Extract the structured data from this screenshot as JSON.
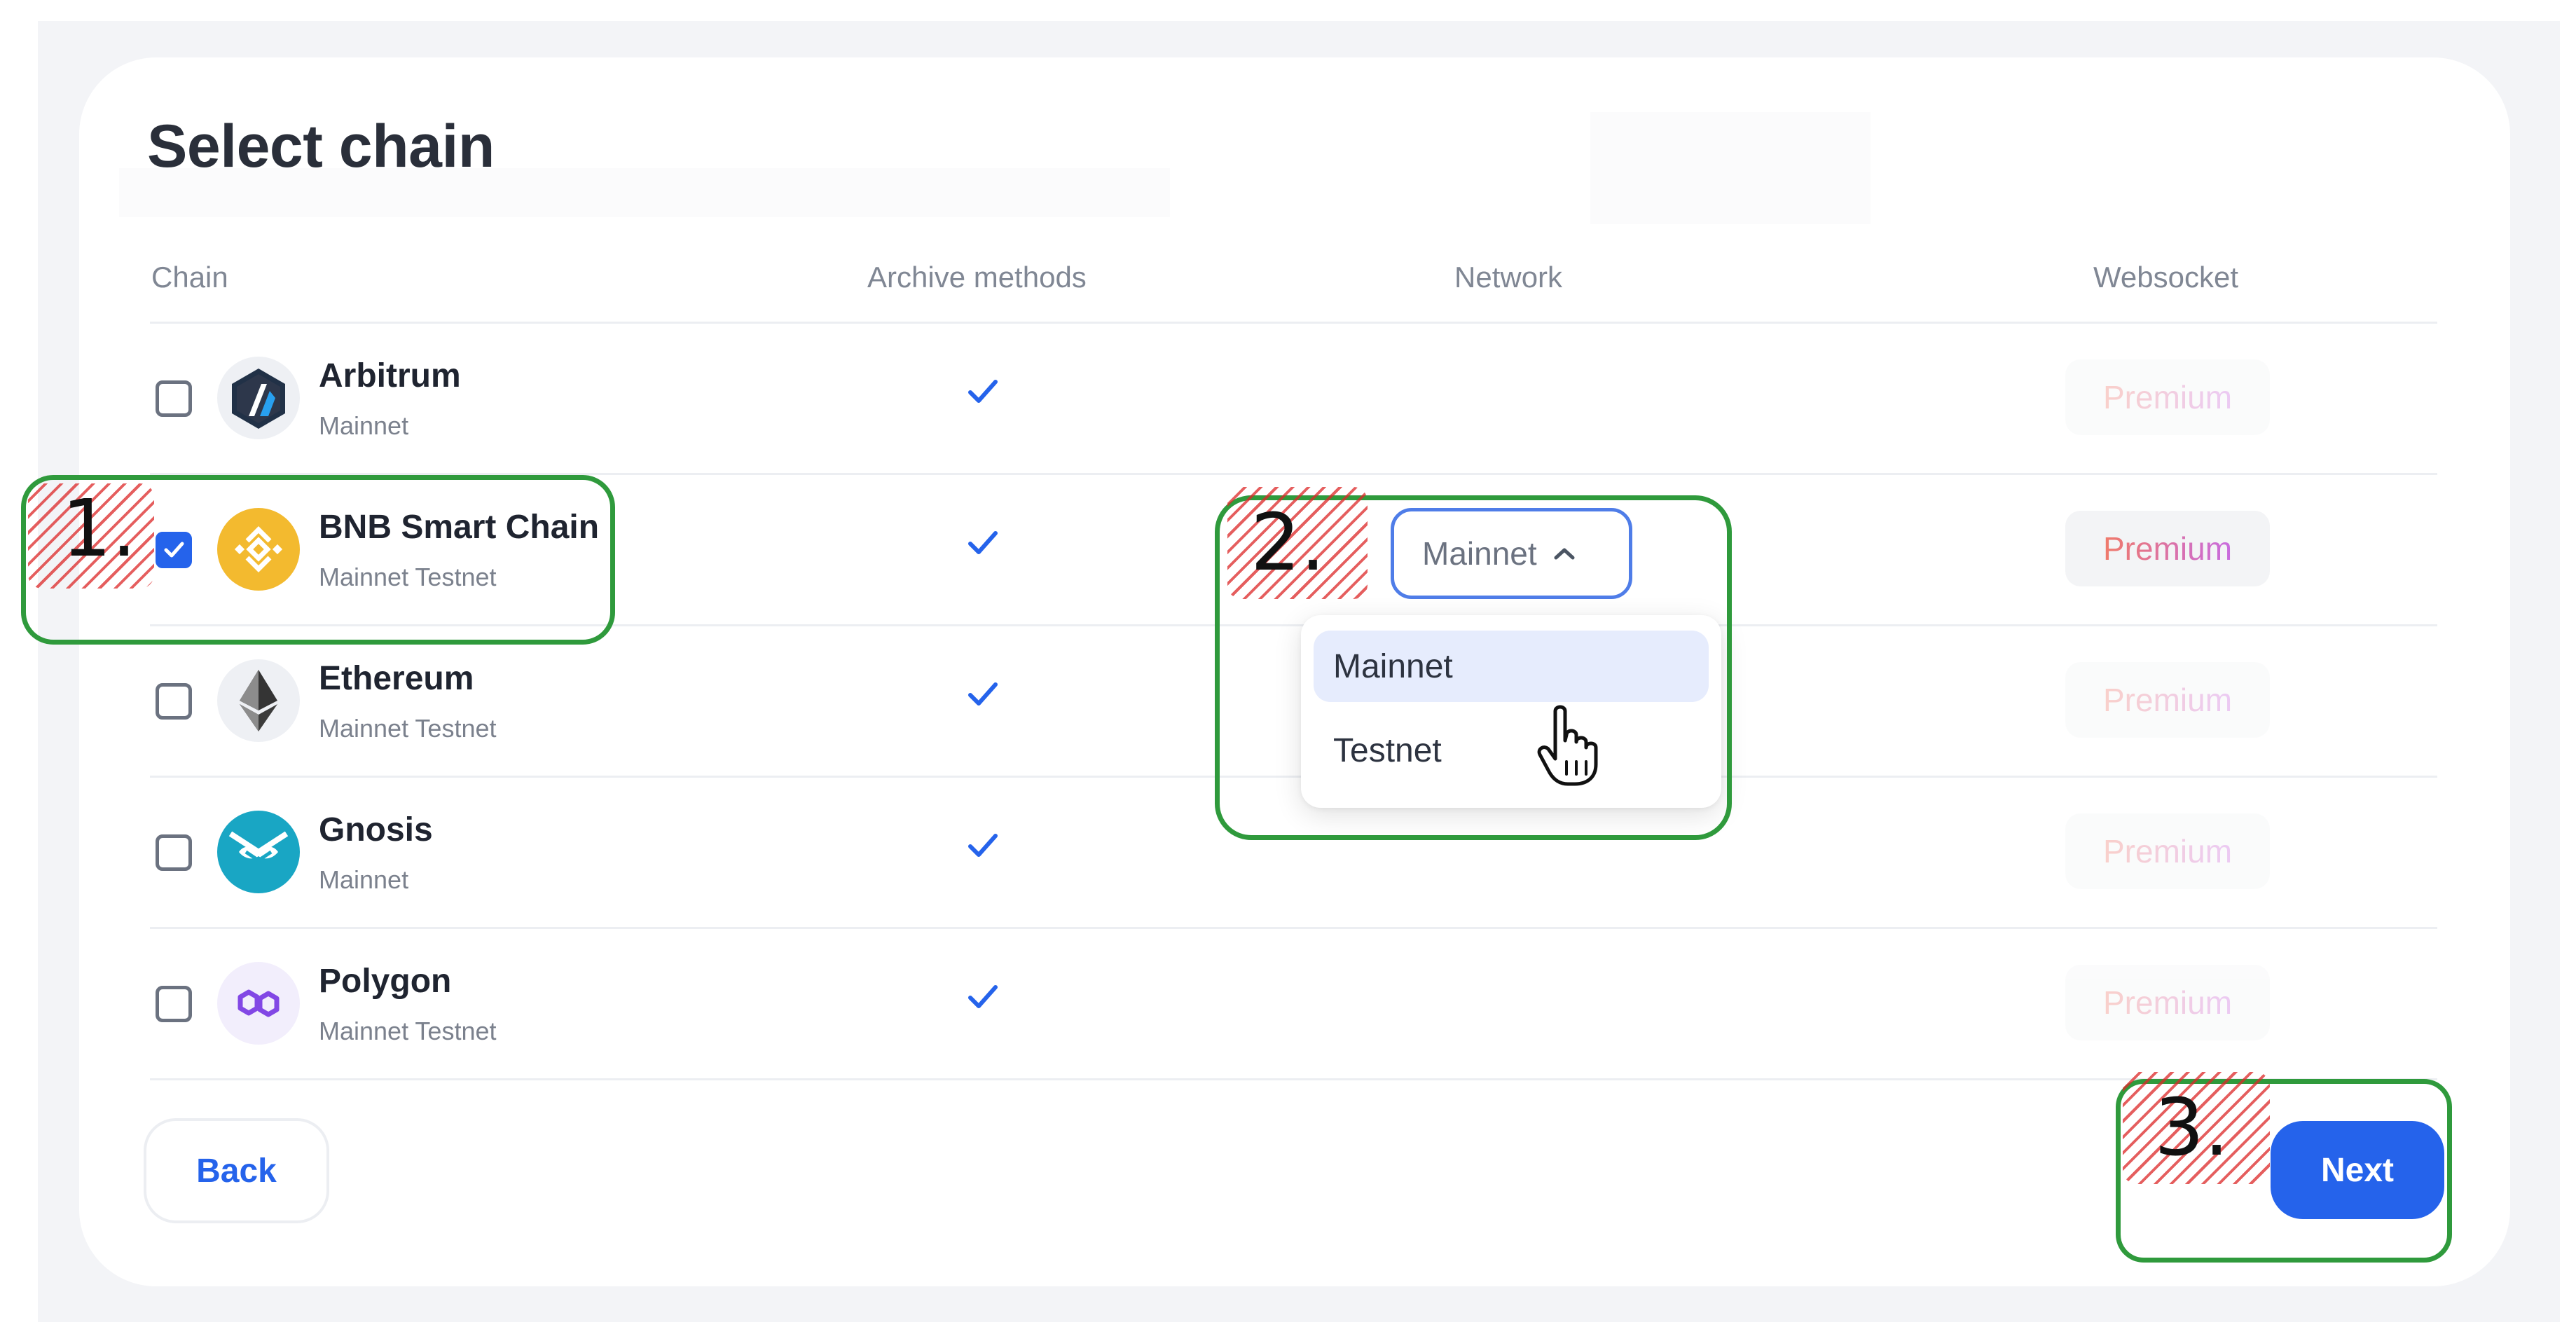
{
  "page": {
    "title": "Select chain"
  },
  "table": {
    "headers": {
      "chain": "Chain",
      "archive": "Archive methods",
      "network": "Network",
      "websocket": "Websocket"
    },
    "archive_mark": "✓",
    "rows": [
      {
        "name": "Arbitrum",
        "networks": "Mainnet",
        "checked": false,
        "premium": "Premium",
        "logo_icon": "arbitrum-logo-icon"
      },
      {
        "name": "BNB Smart Chain",
        "networks": "Mainnet Testnet",
        "checked": true,
        "premium": "Premium",
        "logo_icon": "bnb-logo-icon"
      },
      {
        "name": "Ethereum",
        "networks": "Mainnet Testnet",
        "checked": false,
        "premium": "Premium",
        "logo_icon": "ethereum-logo-icon"
      },
      {
        "name": "Gnosis",
        "networks": "Mainnet",
        "checked": false,
        "premium": "Premium",
        "logo_icon": "gnosis-logo-icon"
      },
      {
        "name": "Polygon",
        "networks": "Mainnet Testnet",
        "checked": false,
        "premium": "Premium",
        "logo_icon": "polygon-logo-icon"
      }
    ]
  },
  "network_select": {
    "value": "Mainnet",
    "options": [
      "Mainnet",
      "Testnet"
    ],
    "highlighted": "Mainnet"
  },
  "footer": {
    "back_label": "Back",
    "next_label": "Next"
  },
  "annotations": {
    "step1": "1.",
    "step2": "2.",
    "step3": "3."
  },
  "colors": {
    "accent": "#2563eb",
    "annotation_box": "#2f9a3c",
    "hatch": "#dc2828",
    "bnb": "#f3ba2f",
    "gnosis": "#19a6c4",
    "polygon": "#8247e5"
  }
}
